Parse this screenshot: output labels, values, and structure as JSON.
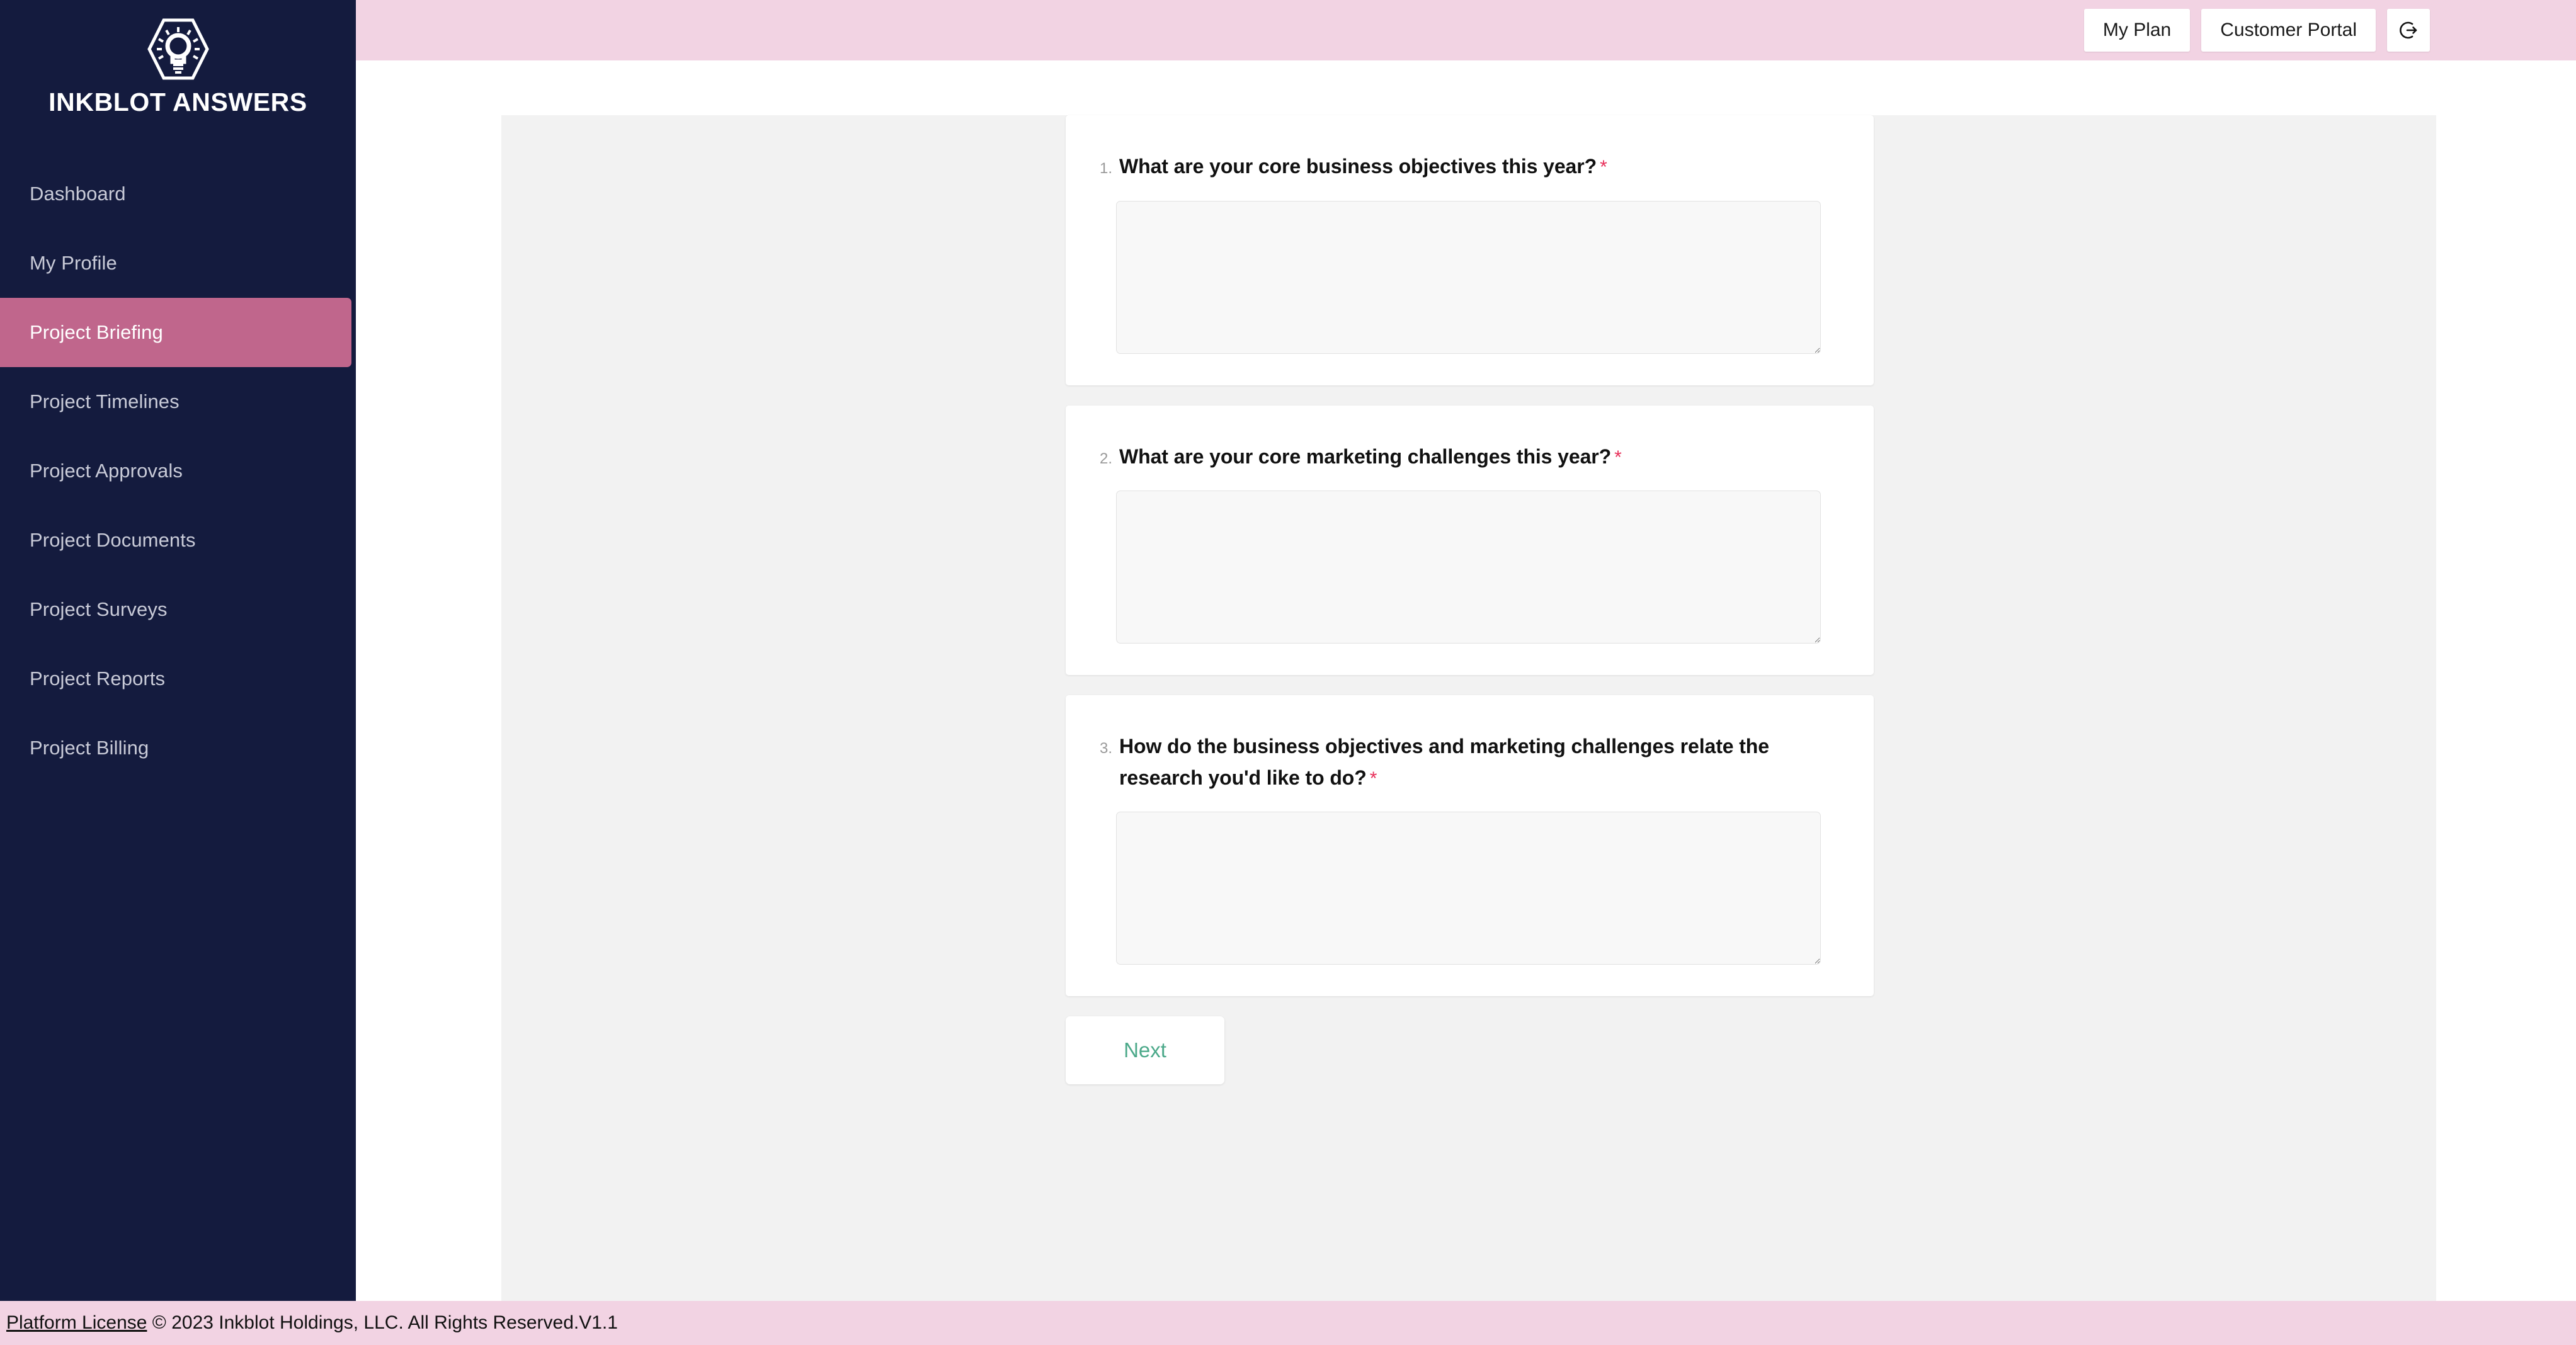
{
  "brand": {
    "name": "INKBLOT ANSWERS",
    "logo_icon": "hexagon-lightbulb-icon"
  },
  "sidebar": {
    "items": [
      {
        "label": "Dashboard",
        "active": false
      },
      {
        "label": "My Profile",
        "active": false
      },
      {
        "label": "Project Briefing",
        "active": true
      },
      {
        "label": "Project Timelines",
        "active": false
      },
      {
        "label": "Project Approvals",
        "active": false
      },
      {
        "label": "Project Documents",
        "active": false
      },
      {
        "label": "Project Surveys",
        "active": false
      },
      {
        "label": "Project Reports",
        "active": false
      },
      {
        "label": "Project Billing",
        "active": false
      }
    ]
  },
  "header": {
    "my_plan_label": "My Plan",
    "customer_portal_label": "Customer Portal",
    "logout_icon": "logout-icon"
  },
  "form": {
    "questions": [
      {
        "number": "1.",
        "text": "What are your core business objectives this year?",
        "required_marker": "*",
        "answer": "",
        "placeholder": ""
      },
      {
        "number": "2.",
        "text": "What are your core marketing challenges this year?",
        "required_marker": "*",
        "answer": "",
        "placeholder": ""
      },
      {
        "number": "3.",
        "text": "How do the business objectives and marketing challenges relate the research you'd like to do?",
        "required_marker": "*",
        "answer": "",
        "placeholder": ""
      }
    ],
    "next_label": "Next"
  },
  "footer": {
    "link_label": "Platform License",
    "copyright": " © 2023 Inkblot Holdings, LLC. All Rights Reserved.V1.1"
  },
  "colors": {
    "sidebar_bg": "#141B3E",
    "active_item": "#C0668C",
    "header_bg": "#F2D3E3",
    "panel_bg": "#F2F2F2",
    "required": "#E8315B",
    "next_text": "#4CA98A"
  }
}
